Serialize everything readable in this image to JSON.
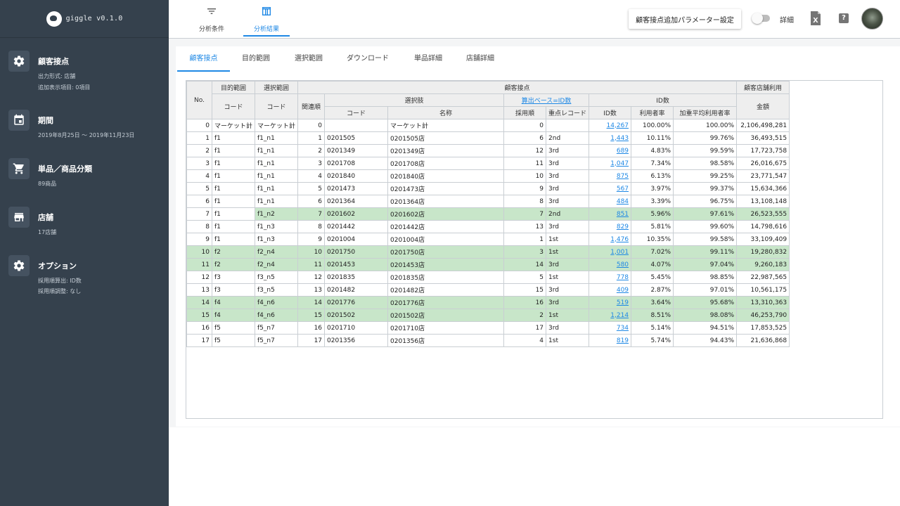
{
  "app": {
    "name": "giggle v0.1.0"
  },
  "sidebar": {
    "items": [
      {
        "icon": "gear-icon",
        "title": "顧客接点",
        "subs": [
          "出力形式: 店舗",
          "追加表示項目: 0項目"
        ]
      },
      {
        "icon": "calendar-icon",
        "title": "期間",
        "subs": [
          "2019年8月25日 〜 2019年11月23日"
        ]
      },
      {
        "icon": "cart-icon",
        "title": "単品／商品分類",
        "subs": [
          "89商品"
        ]
      },
      {
        "icon": "store-icon",
        "title": "店舗",
        "subs": [
          "17店舗"
        ]
      },
      {
        "icon": "gear-icon",
        "title": "オプション",
        "subs": [
          "採用順算出: ID数",
          "採用順調整: なし"
        ]
      }
    ]
  },
  "topbar": {
    "tabs": [
      {
        "label": "分析条件",
        "icon": "filter-icon",
        "active": false
      },
      {
        "label": "分析結果",
        "icon": "table-icon",
        "active": true
      }
    ],
    "param_button": "顧客接点追加パラメーター設定",
    "toggle_label": "詳細",
    "toggle_on": false
  },
  "subtabs": [
    "顧客接点",
    "目的範囲",
    "選択範囲",
    "ダウンロード",
    "単品詳細",
    "店舗詳細"
  ],
  "table": {
    "headers": {
      "no": "No.",
      "purpose_range": "目的範囲",
      "select_range": "選択範囲",
      "customer_touchpoint": "顧客接点",
      "store_usage": "顧客店舗利用",
      "code": "コード",
      "relation_order": "関連順",
      "choice": "選択肢",
      "calc_base": "算出ベース=ID数",
      "id_count_group": "ID数",
      "amount": "金額",
      "choice_code": "コード",
      "choice_name": "名称",
      "adoption_order": "採用順",
      "priority_record": "重点レコード",
      "id_count": "ID数",
      "usage_rate": "利用者率",
      "weighted_avg_rate": "加重平均利用者率"
    },
    "rows": [
      {
        "no": "0",
        "purpose": "マーケット計",
        "select": "マーケット計",
        "rel": "0",
        "code": "",
        "name": "マーケット計",
        "adopt": "0",
        "priority": "",
        "ids": "14,267",
        "rate": "100.00%",
        "wavg": "100.00%",
        "amount": "2,106,498,281",
        "hl": false
      },
      {
        "no": "1",
        "purpose": "f1",
        "select": "f1_n1",
        "rel": "1",
        "code": "0201505",
        "name": "0201505店",
        "adopt": "6",
        "priority": "2nd",
        "ids": "1,443",
        "rate": "10.11%",
        "wavg": "99.76%",
        "amount": "36,493,515",
        "hl": false
      },
      {
        "no": "2",
        "purpose": "f1",
        "select": "f1_n1",
        "rel": "2",
        "code": "0201349",
        "name": "0201349店",
        "adopt": "12",
        "priority": "3rd",
        "ids": "689",
        "rate": "4.83%",
        "wavg": "99.59%",
        "amount": "17,723,758",
        "hl": false
      },
      {
        "no": "3",
        "purpose": "f1",
        "select": "f1_n1",
        "rel": "3",
        "code": "0201708",
        "name": "0201708店",
        "adopt": "11",
        "priority": "3rd",
        "ids": "1,047",
        "rate": "7.34%",
        "wavg": "98.58%",
        "amount": "26,016,675",
        "hl": false
      },
      {
        "no": "4",
        "purpose": "f1",
        "select": "f1_n1",
        "rel": "4",
        "code": "0201840",
        "name": "0201840店",
        "adopt": "10",
        "priority": "3rd",
        "ids": "875",
        "rate": "6.13%",
        "wavg": "99.25%",
        "amount": "23,771,547",
        "hl": false
      },
      {
        "no": "5",
        "purpose": "f1",
        "select": "f1_n1",
        "rel": "5",
        "code": "0201473",
        "name": "0201473店",
        "adopt": "9",
        "priority": "3rd",
        "ids": "567",
        "rate": "3.97%",
        "wavg": "99.37%",
        "amount": "15,634,366",
        "hl": false
      },
      {
        "no": "6",
        "purpose": "f1",
        "select": "f1_n1",
        "rel": "6",
        "code": "0201364",
        "name": "0201364店",
        "adopt": "8",
        "priority": "3rd",
        "ids": "484",
        "rate": "3.39%",
        "wavg": "96.75%",
        "amount": "13,108,148",
        "hl": false
      },
      {
        "no": "7",
        "purpose": "f1",
        "select": "f1_n2",
        "rel": "7",
        "code": "0201602",
        "name": "0201602店",
        "adopt": "7",
        "priority": "2nd",
        "ids": "851",
        "rate": "5.96%",
        "wavg": "97.61%",
        "amount": "26,523,555",
        "hl": true,
        "partial": true
      },
      {
        "no": "8",
        "purpose": "f1",
        "select": "f1_n3",
        "rel": "8",
        "code": "0201442",
        "name": "0201442店",
        "adopt": "13",
        "priority": "3rd",
        "ids": "829",
        "rate": "5.81%",
        "wavg": "99.60%",
        "amount": "14,798,616",
        "hl": false
      },
      {
        "no": "9",
        "purpose": "f1",
        "select": "f1_n3",
        "rel": "9",
        "code": "0201004",
        "name": "0201004店",
        "adopt": "1",
        "priority": "1st",
        "ids": "1,476",
        "rate": "10.35%",
        "wavg": "99.58%",
        "amount": "33,109,409",
        "hl": false
      },
      {
        "no": "10",
        "purpose": "f2",
        "select": "f2_n4",
        "rel": "10",
        "code": "0201750",
        "name": "0201750店",
        "adopt": "3",
        "priority": "1st",
        "ids": "1,001",
        "rate": "7.02%",
        "wavg": "99.11%",
        "amount": "19,280,832",
        "hl": true
      },
      {
        "no": "11",
        "purpose": "f2",
        "select": "f2_n4",
        "rel": "11",
        "code": "0201453",
        "name": "0201453店",
        "adopt": "14",
        "priority": "3rd",
        "ids": "580",
        "rate": "4.07%",
        "wavg": "97.04%",
        "amount": "9,260,183",
        "hl": true
      },
      {
        "no": "12",
        "purpose": "f3",
        "select": "f3_n5",
        "rel": "12",
        "code": "0201835",
        "name": "0201835店",
        "adopt": "5",
        "priority": "1st",
        "ids": "778",
        "rate": "5.45%",
        "wavg": "98.85%",
        "amount": "22,987,565",
        "hl": false
      },
      {
        "no": "13",
        "purpose": "f3",
        "select": "f3_n5",
        "rel": "13",
        "code": "0201482",
        "name": "0201482店",
        "adopt": "15",
        "priority": "3rd",
        "ids": "409",
        "rate": "2.87%",
        "wavg": "97.01%",
        "amount": "10,561,175",
        "hl": false
      },
      {
        "no": "14",
        "purpose": "f4",
        "select": "f4_n6",
        "rel": "14",
        "code": "0201776",
        "name": "0201776店",
        "adopt": "16",
        "priority": "3rd",
        "ids": "519",
        "rate": "3.64%",
        "wavg": "95.68%",
        "amount": "13,310,363",
        "hl": true
      },
      {
        "no": "15",
        "purpose": "f4",
        "select": "f4_n6",
        "rel": "15",
        "code": "0201502",
        "name": "0201502店",
        "adopt": "2",
        "priority": "1st",
        "ids": "1,214",
        "rate": "8.51%",
        "wavg": "98.08%",
        "amount": "46,253,790",
        "hl": true
      },
      {
        "no": "16",
        "purpose": "f5",
        "select": "f5_n7",
        "rel": "16",
        "code": "0201710",
        "name": "0201710店",
        "adopt": "17",
        "priority": "3rd",
        "ids": "734",
        "rate": "5.14%",
        "wavg": "94.51%",
        "amount": "17,853,525",
        "hl": false
      },
      {
        "no": "17",
        "purpose": "f5",
        "select": "f5_n7",
        "rel": "17",
        "code": "0201356",
        "name": "0201356店",
        "adopt": "4",
        "priority": "1st",
        "ids": "819",
        "rate": "5.74%",
        "wavg": "94.43%",
        "amount": "21,636,868",
        "hl": false
      }
    ]
  }
}
